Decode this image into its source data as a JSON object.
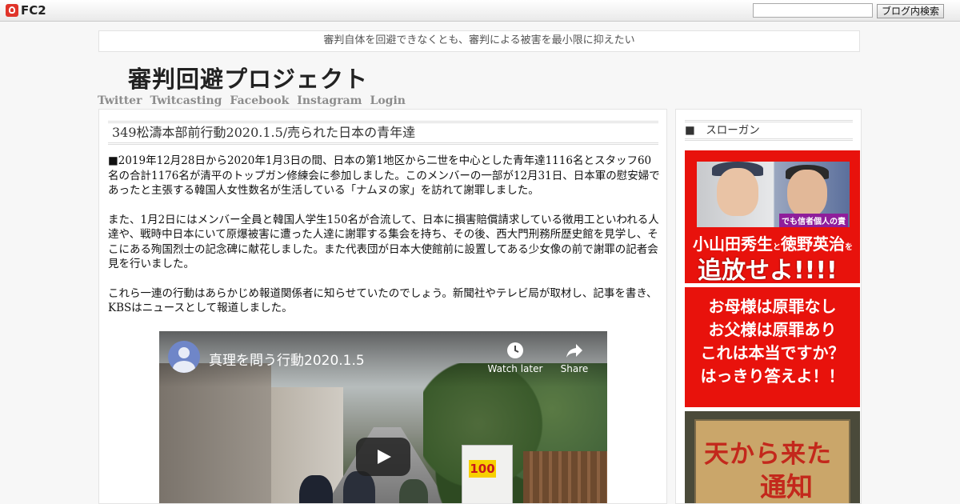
{
  "fc2bar": {
    "logo": "FC2",
    "search_placeholder": "",
    "search_button": "ブログ内検索"
  },
  "header": {
    "tagline": "審判自体を回避できなくとも、審判による被害を最小限に抑えたい",
    "title": "審判回避プロジェクト",
    "nav": [
      "Twitter",
      "Twitcasting",
      "Facebook",
      "Instagram",
      "Login"
    ]
  },
  "entry": {
    "title": "349松濤本部前行動2020.1.5/売られた日本の青年達",
    "paragraphs": [
      "■2019年12月28日から2020年1月3日の間、日本の第1地区から二世を中心とした青年達1116名とスタッフ60名の合計1176名が清平のトップガン修練会に参加しました。このメンバーの一部が12月31日、日本軍の慰安婦であったと主張する韓国人女性数名が生活している「ナムヌの家」を訪れて謝罪しました。",
      "また、1月2日にはメンバー全員と韓国人学生150名が合流して、日本に損害賠償請求している徴用工といわれる人達や、戦時中日本にいて原爆被害に遭った人達に謝罪する集会を持ち、その後、西大門刑務所歴史館を見学し、そこにある殉国烈士の記念碑に献花しました。また代表団が日本大使館前に設置してある少女像の前で謝罪の記者会見を行いました。",
      "これら一連の行動はあらかじめ報道関係者に知らせていたのでしょう。新聞社やテレビ局が取材し、記事を書き、KBSはニュースとして報道しました。"
    ],
    "video": {
      "title": "真理を問う行動2020.1.5",
      "watch_later": "Watch later",
      "share": "Share",
      "vending_sign": "100"
    }
  },
  "sidebar": {
    "section_title": "■　スローガン",
    "banner1": {
      "caption": "でも信者個人の責",
      "line1_a": "小山田秀生",
      "line1_b": "と",
      "line1_c": "徳野英治",
      "line1_d": "を",
      "line2": "追放せよ!!!!"
    },
    "banner2": {
      "lines": [
        "お母様は原罪なし",
        "お父様は原罪あり",
        "これは本当ですか？",
        "はっきり答えよ！！"
      ]
    },
    "banner3": {
      "line1": "天から来た",
      "line2": "通知"
    }
  },
  "colors": {
    "banner_red": "#e8120c",
    "nav_gray": "#8c8c8c"
  }
}
